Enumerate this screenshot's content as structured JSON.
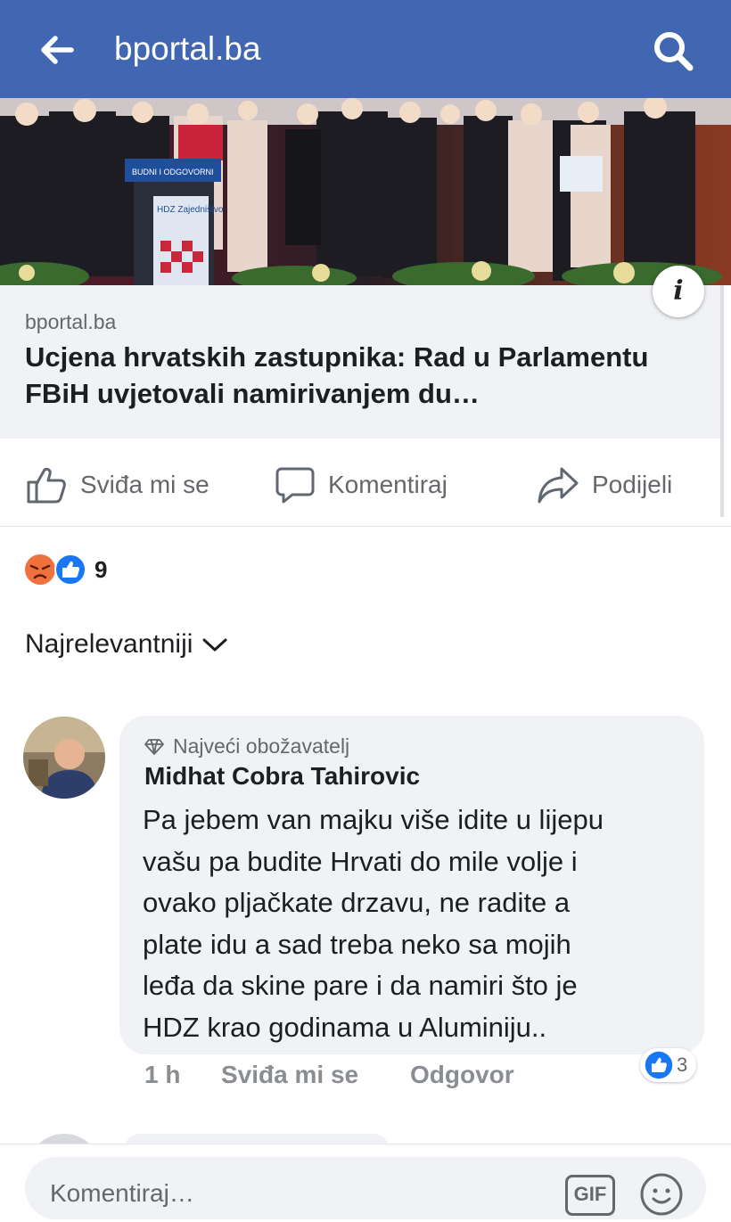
{
  "header": {
    "title": "bportal.ba",
    "back_icon": "arrow-left-icon",
    "search_icon": "search-icon",
    "bg": "#4267b2"
  },
  "link_preview": {
    "domain": "bportal.ba",
    "title": "Ucjena hrvatskih zastupnika: Rad u Parlamentu FBiH uvjetovali namirivanjem du…",
    "info_label": "i",
    "podium_sign": "BUDNI I ODGOVORNI",
    "banner_text": "HDZ Zajedništvo"
  },
  "actions": {
    "like": "Sviđa mi se",
    "comment": "Komentiraj",
    "share": "Podijeli"
  },
  "reactions": {
    "count": "9",
    "icons": [
      "angry-icon",
      "like-icon"
    ]
  },
  "sort": {
    "label": "Najrelevantniji"
  },
  "comment": {
    "badge": "Najveći obožavatelj",
    "author": "Midhat Cobra Tahirovic",
    "lines": [
      "Pa jebem van majku više idite u lijepu",
      "vašu pa budite Hrvati do mile volje i",
      "ovako pljačkate drzavu, ne radite a",
      "plate idu a sad treba neko sa mojih",
      "leđa da skine pare i da namiri što je",
      "HDZ krao godinama u Aluminiju.."
    ],
    "time": "1 h",
    "like": "Sviđa mi se",
    "reply": "Odgovor",
    "like_count": "3"
  },
  "composer": {
    "placeholder": "Komentiraj…",
    "gif": "GIF",
    "emoji_icon": "smiley-icon"
  },
  "colors": {
    "fb_blue": "#4267b2",
    "like_blue": "#1877f2",
    "angry": "#f0713d",
    "bubble": "#f0f2f5",
    "muted": "#65676b"
  }
}
